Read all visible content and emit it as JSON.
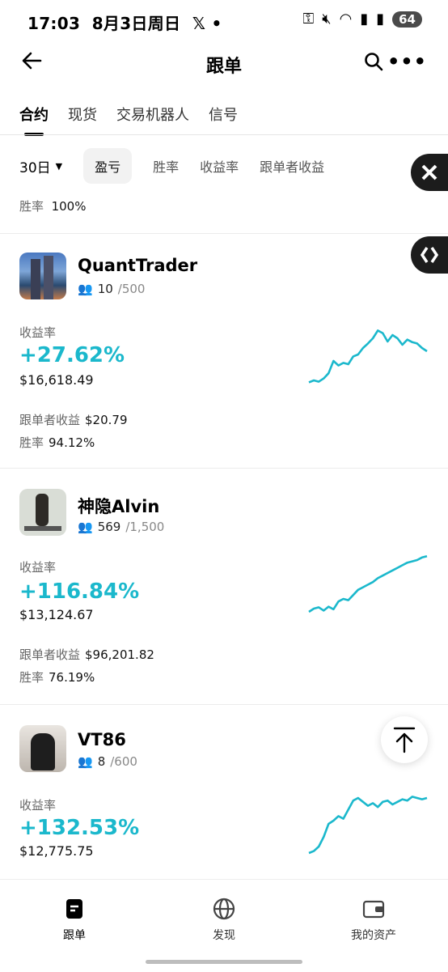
{
  "status": {
    "time": "17:03",
    "date": "8月3日周日",
    "battery": "64"
  },
  "header": {
    "title": "跟单"
  },
  "tabs": [
    "合约",
    "现货",
    "交易机器人",
    "信号"
  ],
  "filters": {
    "period": "30日",
    "chips": [
      "盈亏",
      "胜率",
      "收益率",
      "跟单者收益"
    ]
  },
  "prev_card": {
    "winrate_label": "胜率",
    "winrate": "100%"
  },
  "traders": [
    {
      "name": "QuantTrader",
      "followers": "10",
      "capacity": "/500",
      "roi_label": "收益率",
      "roi": "+27.62%",
      "pnl": "$16,618.49",
      "copier_label": "跟单者收益",
      "copier": "$20.79",
      "winrate_label": "胜率",
      "winrate": "94.12%",
      "spark": [
        0.12,
        0.15,
        0.13,
        0.18,
        0.26,
        0.45,
        0.38,
        0.42,
        0.4,
        0.52,
        0.55,
        0.65,
        0.72,
        0.8,
        0.92,
        0.88,
        0.75,
        0.85,
        0.8,
        0.7,
        0.78,
        0.74,
        0.72,
        0.65,
        0.6
      ]
    },
    {
      "name": "神隐Alvin",
      "followers": "569",
      "capacity": "/1,500",
      "roi_label": "收益率",
      "roi": "+116.84%",
      "pnl": "$13,124.67",
      "copier_label": "跟单者收益",
      "copier": "$96,201.82",
      "winrate_label": "胜率",
      "winrate": "76.19%",
      "spark": [
        0.1,
        0.15,
        0.17,
        0.12,
        0.18,
        0.14,
        0.26,
        0.3,
        0.28,
        0.36,
        0.44,
        0.48,
        0.52,
        0.56,
        0.62,
        0.66,
        0.7,
        0.74,
        0.78,
        0.82,
        0.86,
        0.88,
        0.9,
        0.94,
        0.96
      ]
    },
    {
      "name": "VT86",
      "followers": "8",
      "capacity": "/600",
      "roi_label": "收益率",
      "roi": "+132.53%",
      "pnl": "$12,775.75",
      "spark": [
        0.05,
        0.08,
        0.15,
        0.3,
        0.5,
        0.55,
        0.62,
        0.58,
        0.72,
        0.86,
        0.9,
        0.84,
        0.78,
        0.82,
        0.76,
        0.84,
        0.86,
        0.8,
        0.84,
        0.88,
        0.86,
        0.92,
        0.9,
        0.88,
        0.9
      ]
    }
  ],
  "nav": [
    "跟单",
    "发现",
    "我的资产"
  ],
  "colors": {
    "accent": "#1bb8cc"
  }
}
